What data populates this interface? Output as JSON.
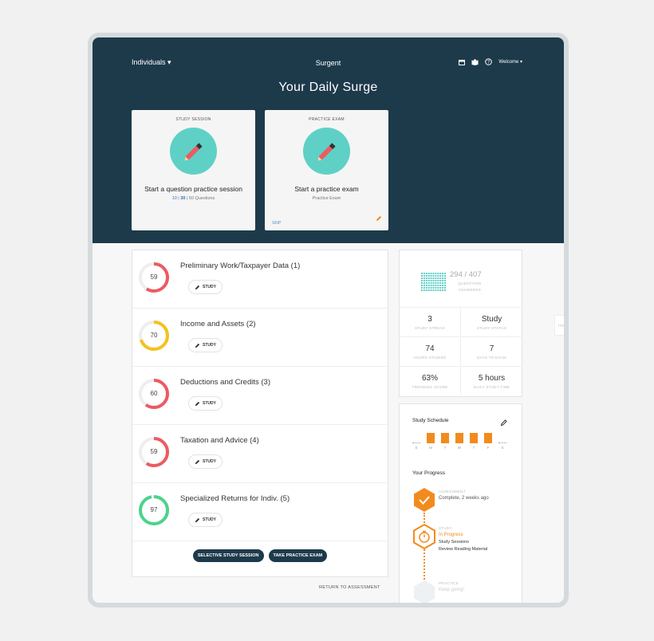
{
  "nav": {
    "left_menu": "Individuals ▾",
    "brand": "Surgent",
    "welcome": "Welcome ▾",
    "icons": [
      "calendar-icon",
      "book-icon",
      "help-icon"
    ]
  },
  "hero": {
    "title": "Your Daily Surge",
    "study_card": {
      "kicker": "STUDY SESSION",
      "title": "Start a question practice session",
      "count_a": "10",
      "count_b": "30",
      "count_rest": "50 Questions",
      "sep": " | "
    },
    "exam_card": {
      "kicker": "PRACTICE EXAM",
      "title": "Start a practice exam",
      "subtitle": "Practice Exam",
      "skip": "SKIP"
    }
  },
  "topics": [
    {
      "title": "Preliminary Work/Taxpayer Data (1)",
      "score": "59",
      "percent": 59,
      "color": "#ec5b62",
      "button": "STUDY"
    },
    {
      "title": "Income and Assets (2)",
      "score": "70",
      "percent": 70,
      "color": "#f5c21b",
      "button": "STUDY"
    },
    {
      "title": "Deductions and Credits (3)",
      "score": "60",
      "percent": 60,
      "color": "#ec5b62",
      "button": "STUDY"
    },
    {
      "title": "Taxation and Advice (4)",
      "score": "59",
      "percent": 59,
      "color": "#ec5b62",
      "button": "STUDY"
    },
    {
      "title": "Specialized Returns for Indiv. (5)",
      "score": "97",
      "percent": 97,
      "color": "#4ad48a",
      "button": "STUDY"
    }
  ],
  "actions": {
    "selective": "SELECTIVE STUDY SESSION",
    "practice": "TAKE PRACTICE EXAM",
    "return": "RETURN TO ASSESSMENT"
  },
  "stats": {
    "questions": "294 / 407",
    "questions_label": "QUESTIONS ANSWERED",
    "items": [
      {
        "value": "3",
        "label": "STUDY STREAK"
      },
      {
        "value": "Study",
        "label": "STUDY STATUS"
      },
      {
        "value": "74",
        "label": "HOURS STUDIED"
      },
      {
        "value": "7",
        "label": "DAYS TO EXAM"
      },
      {
        "value": "63%",
        "label": "TRENDING SCORE"
      },
      {
        "value": "5 hours",
        "label": "DAILY STUDY TIME"
      }
    ]
  },
  "schedule": {
    "title": "Study Schedule",
    "days": [
      {
        "label": "S",
        "active": false
      },
      {
        "label": "M",
        "active": true
      },
      {
        "label": "T",
        "active": true
      },
      {
        "label": "W",
        "active": true
      },
      {
        "label": "T",
        "active": true
      },
      {
        "label": "F",
        "active": true
      },
      {
        "label": "S",
        "active": false
      }
    ]
  },
  "progress": {
    "title": "Your Progress",
    "assessment_kicker": "ASSESSMENT",
    "assessment_status": "Complete, 2 weeks ago",
    "study_kicker": "STUDY",
    "study_status": "In Progress",
    "study_line1": "Study Sessions",
    "study_line2": "Review Reading Material",
    "practice_kicker": "PRACTICE",
    "practice_status": "Keep going!"
  },
  "side_tab": "TRE",
  "colors": {
    "navy": "#1d3a4b",
    "teal": "#5fd0c6",
    "orange": "#f28b1e"
  }
}
